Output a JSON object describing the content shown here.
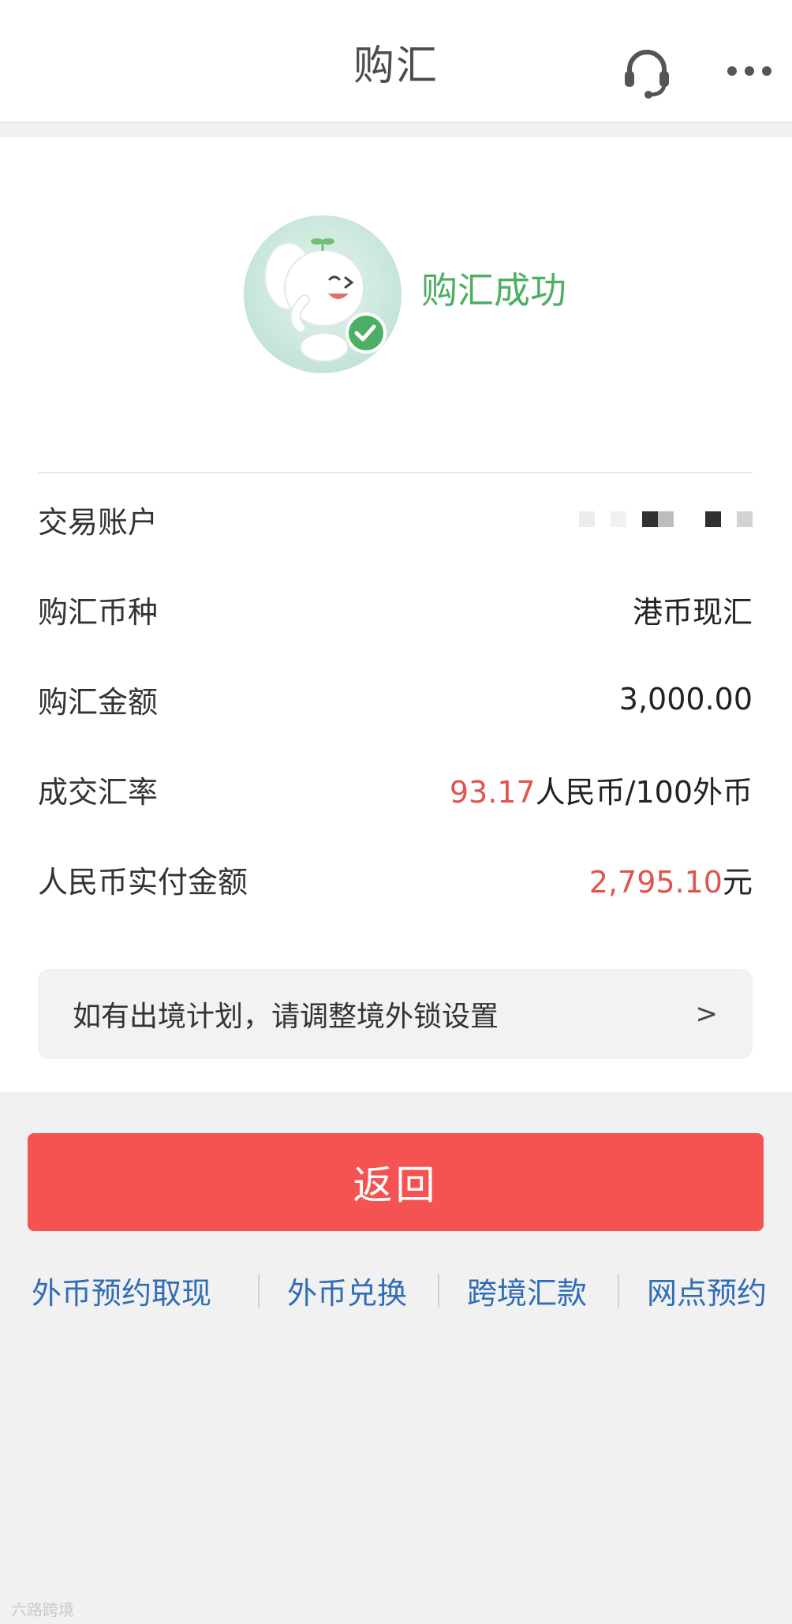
{
  "header": {
    "title": "购汇",
    "icons": [
      "headset-icon",
      "more-icon"
    ]
  },
  "result": {
    "status_text": "购汇成功",
    "mascot_icon": "elephant-mascot-check-icon"
  },
  "details": [
    {
      "label": "交易账户",
      "value": ""
    },
    {
      "label": "购汇币种",
      "value": "港币现汇"
    },
    {
      "label": "购汇金额",
      "value": "3,000.00"
    },
    {
      "label": "成交汇率",
      "value_highlight": "93.17",
      "value_suffix": "人民币/100外币"
    },
    {
      "label": "人民币实付金额",
      "value_highlight": "2,795.10",
      "value_suffix": "元"
    }
  ],
  "tip": {
    "text": "如有出境计划，请调整境外锁设置",
    "arrow": ">"
  },
  "button": {
    "label": "返回"
  },
  "links": [
    "外币预约取现",
    "外币兑换",
    "跨境汇款",
    "网点预约"
  ],
  "watermark": "六路跨境",
  "colors": {
    "success": "#4caf63",
    "highlight": "#e0534f",
    "button": "#f55252",
    "link": "#2f6db5"
  }
}
